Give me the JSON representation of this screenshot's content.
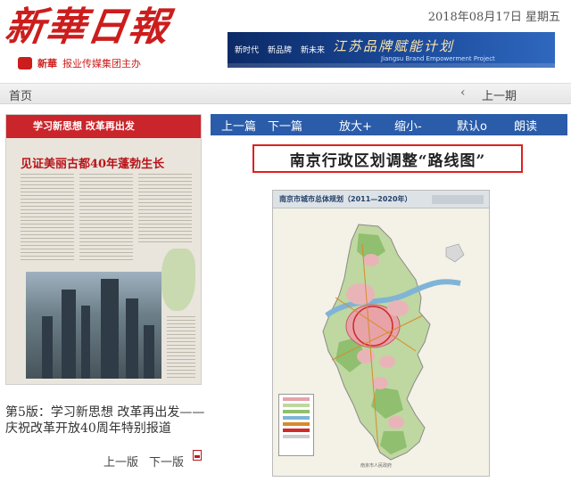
{
  "header": {
    "logo_text": "新華日報",
    "sponsor_mark": "新華",
    "sponsor_text": "报业传媒集团主办",
    "date": "2018年08月17日 星期五",
    "banner": {
      "tags": [
        "新时代",
        "新品牌",
        "新未来"
      ],
      "title": "江苏品牌赋能计划",
      "subtitle": "Jiangsu Brand Empowerment Project"
    }
  },
  "nav": {
    "home": "首页",
    "prev_issue": "上一期"
  },
  "thumbnail": {
    "bar_title": "学习新思想  改革再出发",
    "headline": "见证美丽古都40年蓬勃生长"
  },
  "caption": {
    "text": "第5版：学习新思想  改革再出发——庆祝改革开放40周年特别报道"
  },
  "page_links": {
    "prev": "上一版",
    "next": "下一版"
  },
  "toolbar": {
    "prev_article": "上一篇",
    "next_article": "下一篇",
    "zoom_in": "放大+",
    "zoom_out": "缩小-",
    "default": "默认o",
    "read_aloud": "朗读"
  },
  "article": {
    "title": "南京行政区划调整“路线图”"
  },
  "map": {
    "title": "南京市城市总体规划（2011—2020年）",
    "footer": "南京市人民政府"
  },
  "colors": {
    "brand_red": "#cc1d1d",
    "toolbar_blue": "#2a5caa",
    "highlight_red": "#e02020"
  }
}
